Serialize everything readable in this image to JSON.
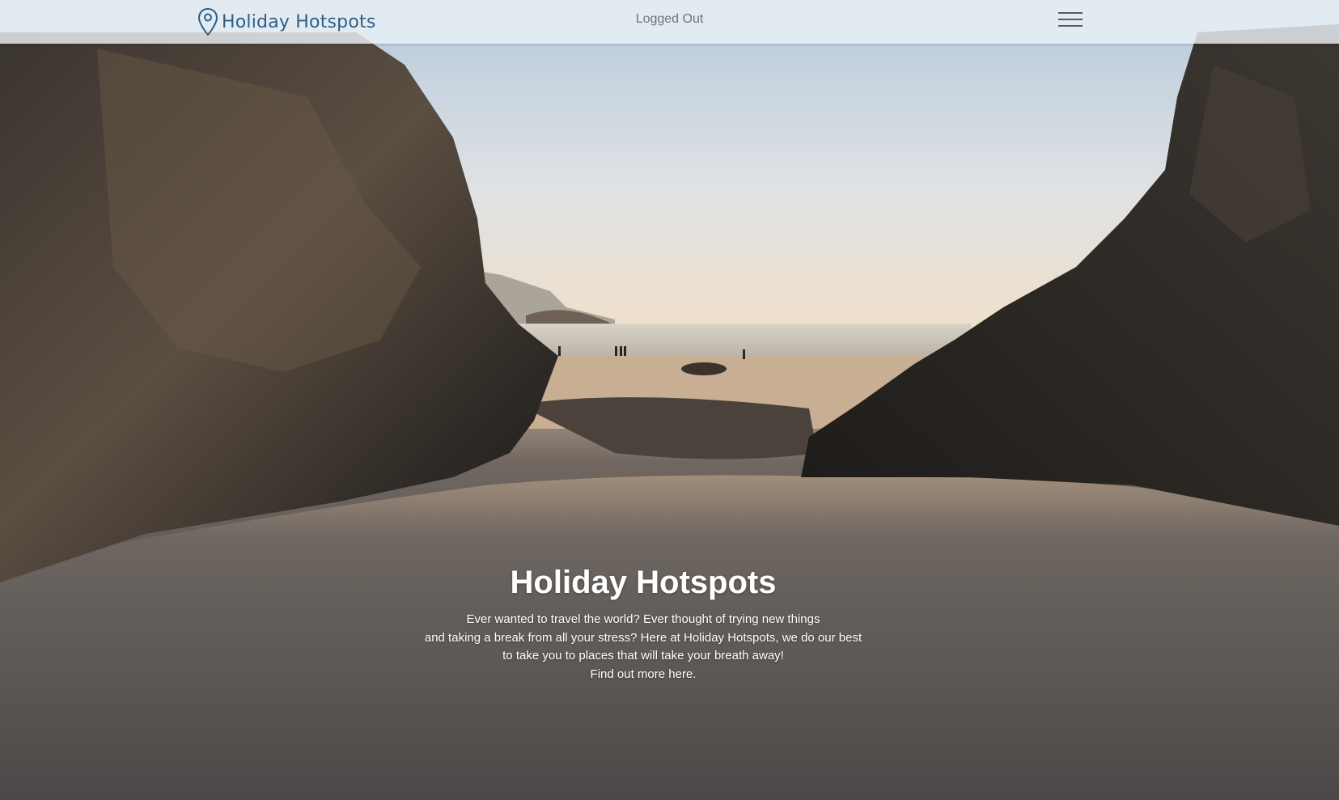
{
  "navbar": {
    "brand": "Holiday Hotspots",
    "status": "Logged Out",
    "menu_icon": "hamburger-menu-icon",
    "brand_icon": "map-pin-icon",
    "brand_color": "#2e5f86"
  },
  "hero": {
    "title": "Holiday Hotspots",
    "lines": [
      "Ever wanted to travel the world? Ever thought of trying new things",
      "and taking a break from all your stress? Here at Holiday Hotspots, we do our best",
      "to take you to places that will take your breath away!"
    ],
    "link_text": "Find out more here."
  }
}
